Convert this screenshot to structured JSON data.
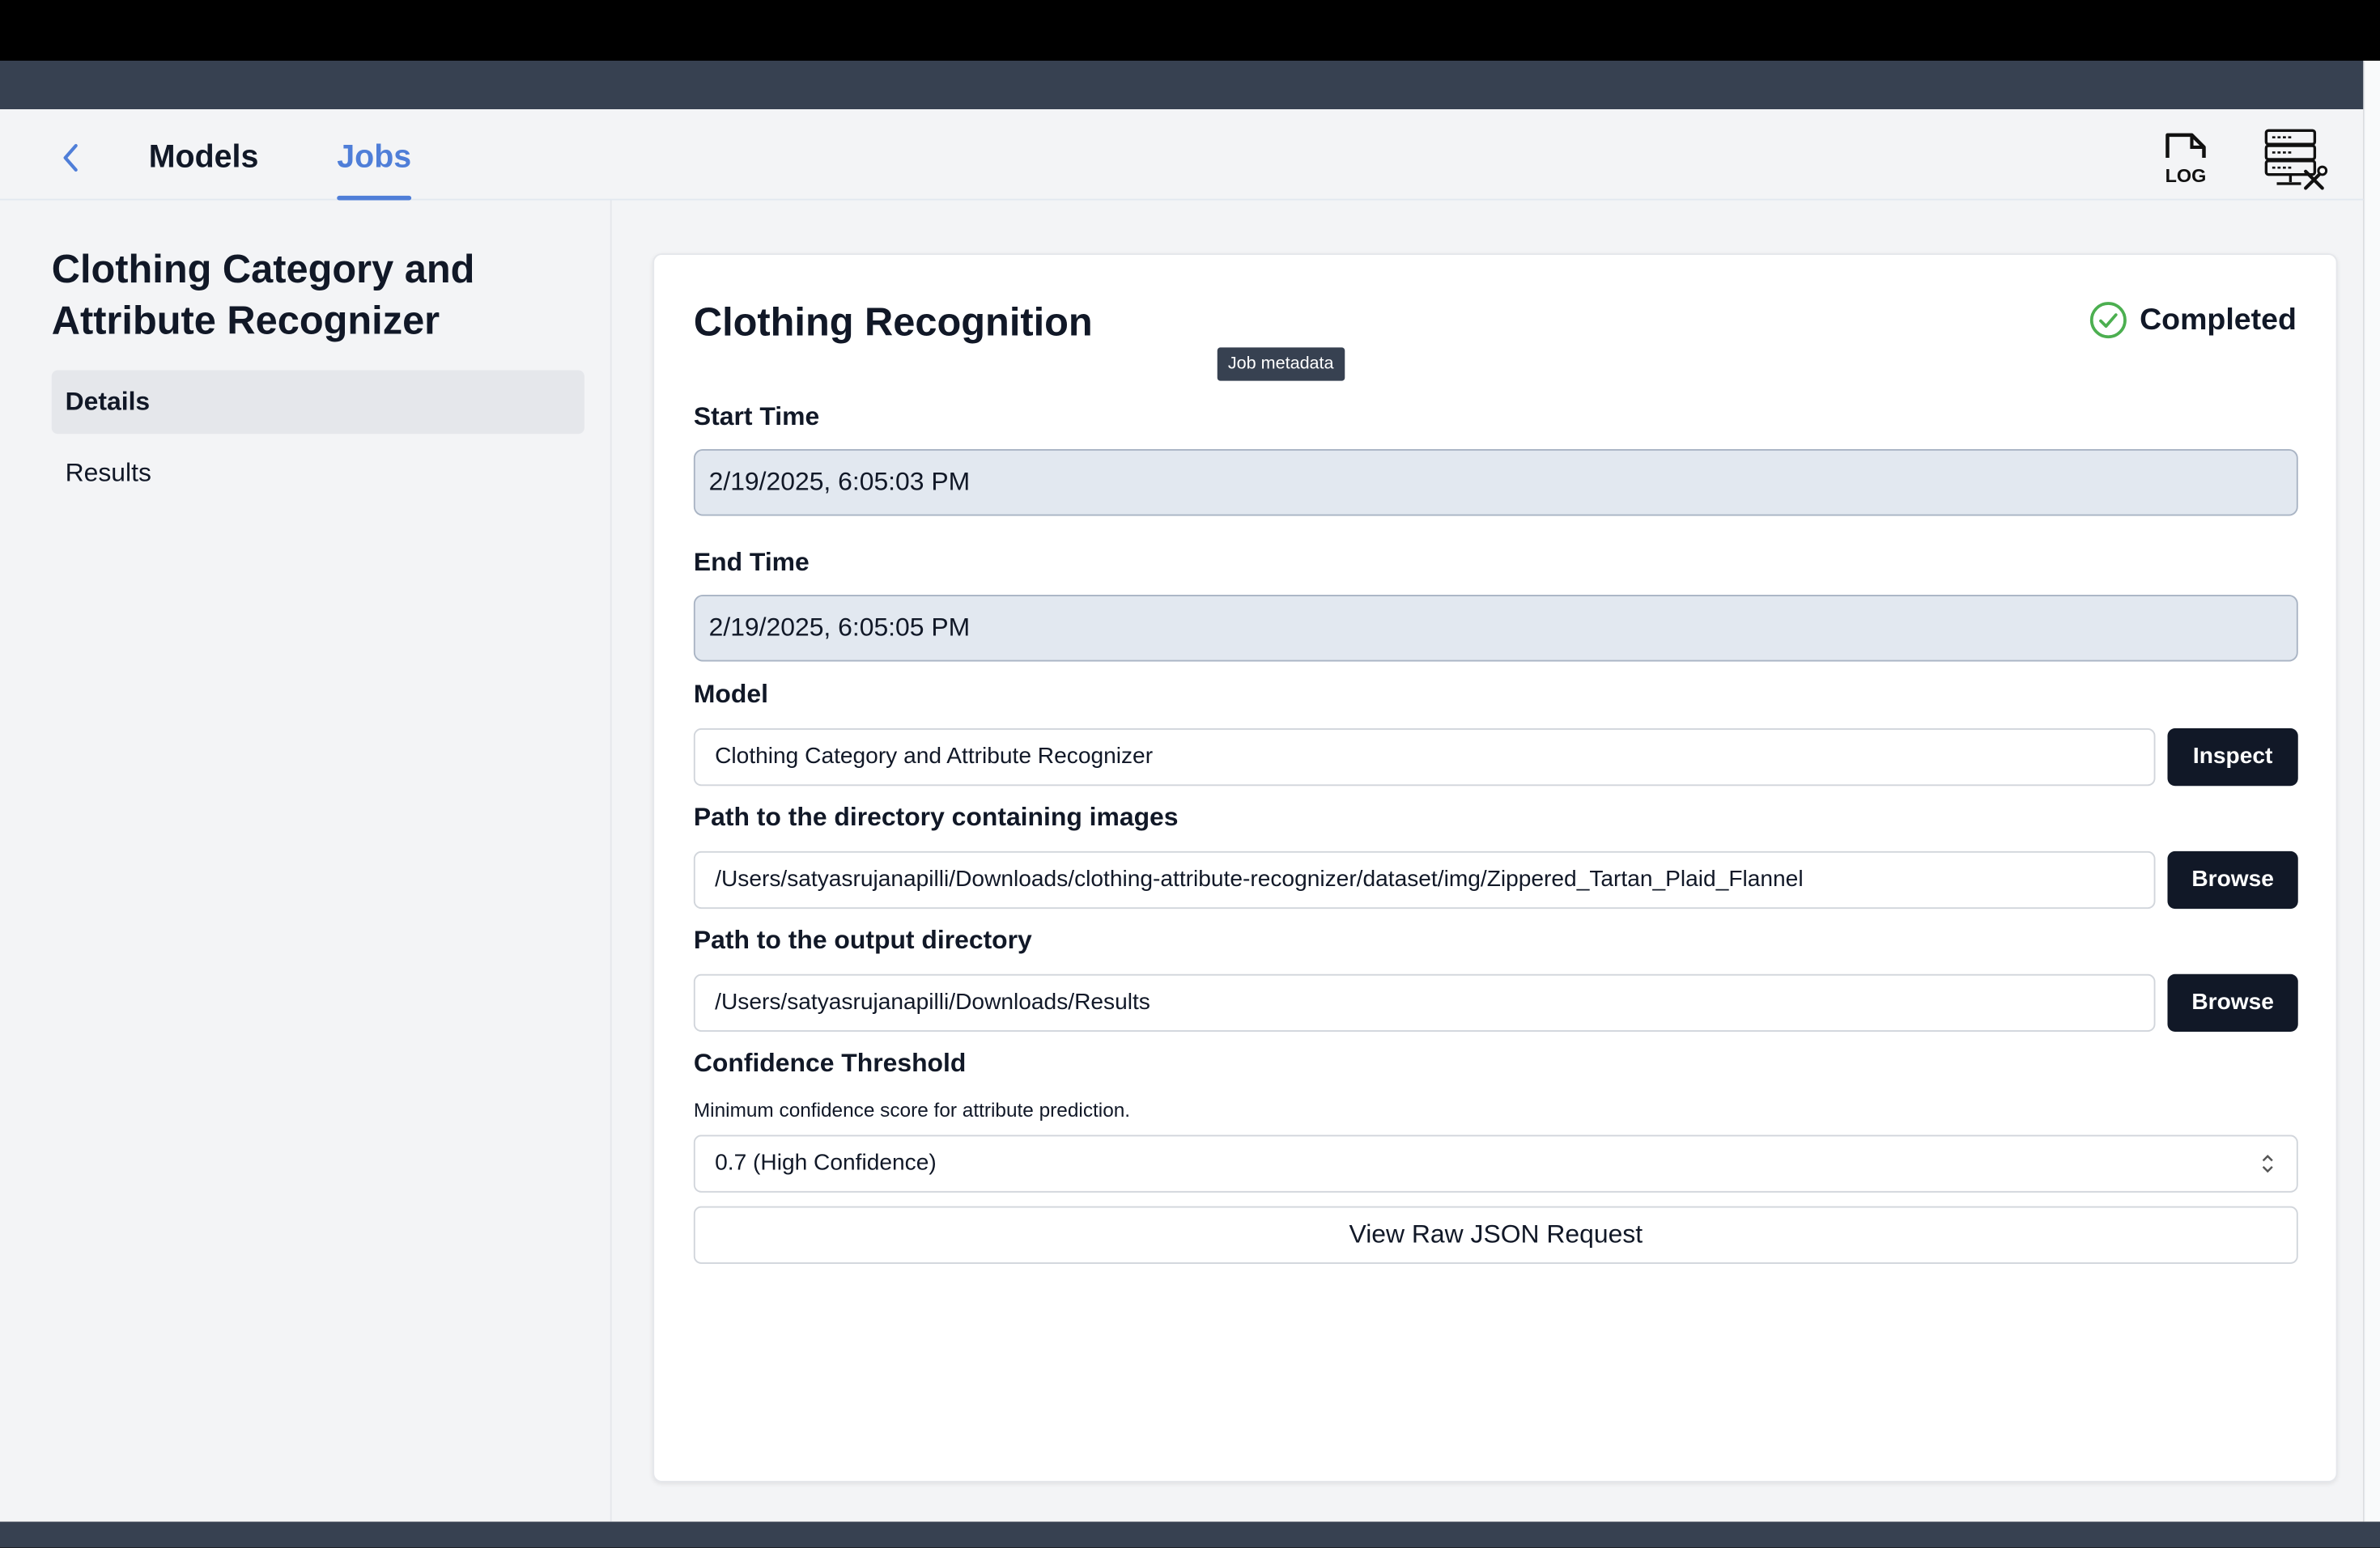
{
  "nav": {
    "back_icon": "chevron-left-icon",
    "tabs": [
      {
        "label": "Models",
        "active": false
      },
      {
        "label": "Jobs",
        "active": true
      }
    ],
    "active_color": "#4f7ed8",
    "log_icon_label": "LOG",
    "log_icon": "log-file-icon",
    "server_icon": "server-tools-icon"
  },
  "sidebar": {
    "title": "Clothing Category and Attribute Recognizer",
    "items": [
      {
        "label": "Details",
        "active": true
      },
      {
        "label": "Results",
        "active": false
      }
    ]
  },
  "job": {
    "title": "Clothing Recognition",
    "status": {
      "label": "Completed",
      "icon": "check-circle-icon",
      "color": "#4caf50"
    },
    "start_time": {
      "label": "Start Time",
      "value": "2/19/2025, 6:05:03 PM"
    },
    "end_time": {
      "label": "End Time",
      "value": "2/19/2025, 6:05:05 PM"
    },
    "tooltip": "Job metadata",
    "model": {
      "label": "Model",
      "value": "Clothing Category and Attribute Recognizer",
      "button": "Inspect"
    },
    "input_dir": {
      "label": "Path to the directory containing images",
      "value": "/Users/satyasrujanapilli/Downloads/clothing-attribute-recognizer/dataset/img/Zippered_Tartan_Plaid_Flannel",
      "button": "Browse"
    },
    "output_dir": {
      "label": "Path to the output directory",
      "value": "/Users/satyasrujanapilli/Downloads/Results",
      "button": "Browse"
    },
    "confidence": {
      "label": "Confidence Threshold",
      "help": "Minimum confidence score for attribute prediction.",
      "selected": "0.7 (High Confidence)"
    },
    "raw_json_button": "View Raw JSON Request"
  }
}
